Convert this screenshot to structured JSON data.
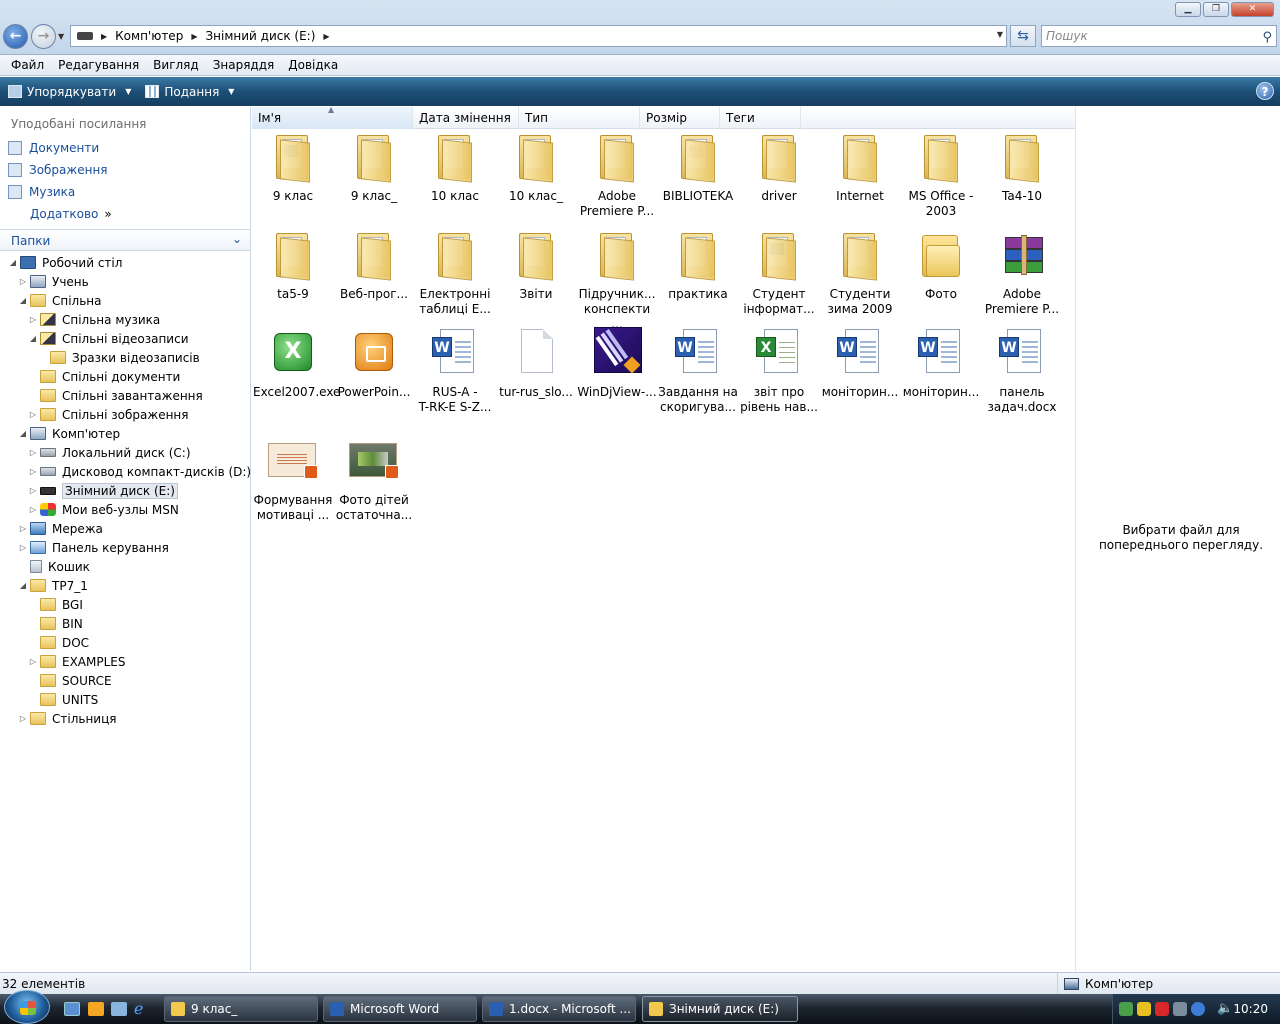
{
  "window": {
    "minimize_label": "▁",
    "maximize_label": "❐",
    "close_label": "✕"
  },
  "address": {
    "segments": [
      "Комп'ютер",
      "Знімний диск (E:)"
    ],
    "search_placeholder": "Пошук"
  },
  "menu": [
    "Файл",
    "Редагування",
    "Вигляд",
    "Знаряддя",
    "Довідка"
  ],
  "toolbar": {
    "organize": "Упорядкувати",
    "views": "Подання",
    "help": "?"
  },
  "favorites": {
    "title": "Уподобані посилання",
    "links": [
      "Документи",
      "Зображення",
      "Музика"
    ],
    "more": "Додатково",
    "more_glyph": "»"
  },
  "folders_pane": {
    "title": "Папки",
    "tree": [
      {
        "label": "Робочий стіл",
        "icon": "desktop-icon"
      },
      {
        "label": "Учень",
        "icon": "user-folder-icon"
      },
      {
        "label": "Спільна",
        "icon": "folder-icon"
      },
      {
        "label": "Спільна музика",
        "icon": "music-folder-icon"
      },
      {
        "label": "Спільні відеозаписи",
        "icon": "video-folder-icon"
      },
      {
        "label": "Зразки відеозаписів",
        "icon": "folder-icon"
      },
      {
        "label": "Спільні документи",
        "icon": "folder-icon"
      },
      {
        "label": "Спільні завантаження",
        "icon": "folder-icon"
      },
      {
        "label": "Спільні зображення",
        "icon": "folder-icon"
      },
      {
        "label": "Комп'ютер",
        "icon": "computer-icon"
      },
      {
        "label": "Локальний диск (C:)",
        "icon": "drive-icon"
      },
      {
        "label": "Дисковод компакт-дисків (D:)",
        "icon": "cd-drive-icon"
      },
      {
        "label": "Знімний диск (E:)",
        "icon": "removable-drive-icon"
      },
      {
        "label": "Мои веб-узлы MSN",
        "icon": "msn-icon"
      },
      {
        "label": "Мережа",
        "icon": "network-icon"
      },
      {
        "label": "Панель керування",
        "icon": "control-panel-icon"
      },
      {
        "label": "Кошик",
        "icon": "recycle-bin-icon"
      },
      {
        "label": "TP7_1",
        "icon": "folder-icon"
      },
      {
        "label": "BGI",
        "icon": "folder-icon"
      },
      {
        "label": "BIN",
        "icon": "folder-icon"
      },
      {
        "label": "DOC",
        "icon": "folder-icon"
      },
      {
        "label": "EXAMPLES",
        "icon": "folder-icon"
      },
      {
        "label": "SOURCE",
        "icon": "folder-icon"
      },
      {
        "label": "UNITS",
        "icon": "folder-icon"
      },
      {
        "label": "Стільниця",
        "icon": "folder-icon"
      }
    ]
  },
  "columns": [
    "Ім'я",
    "Дата змінення",
    "Тип",
    "Розмір",
    "Теги"
  ],
  "files": [
    {
      "line1": "9 клас",
      "line2": "",
      "icon": "folder-icon"
    },
    {
      "line1": "9 клас_",
      "line2": "",
      "icon": "folder-icon"
    },
    {
      "line1": "10 клас",
      "line2": "",
      "icon": "folder-icon"
    },
    {
      "line1": "10 клас_",
      "line2": "",
      "icon": "folder-icon"
    },
    {
      "line1": "Adobe",
      "line2": "Premiere P...",
      "icon": "folder-icon"
    },
    {
      "line1": "BIBLIOTEKA",
      "line2": "",
      "icon": "folder-icon"
    },
    {
      "line1": "driver",
      "line2": "",
      "icon": "folder-icon"
    },
    {
      "line1": "Internet",
      "line2": "",
      "icon": "folder-icon"
    },
    {
      "line1": "MS Office -",
      "line2": "2003",
      "icon": "folder-icon"
    },
    {
      "line1": "Ta4-10",
      "line2": "",
      "icon": "folder-icon"
    },
    {
      "line1": "ta5-9",
      "line2": "",
      "icon": "folder-icon"
    },
    {
      "line1": "Веб-прог...",
      "line2": "",
      "icon": "folder-icon"
    },
    {
      "line1": "Електронні",
      "line2": "таблиці Е...",
      "icon": "folder-icon"
    },
    {
      "line1": "Звіти",
      "line2": "",
      "icon": "folder-icon"
    },
    {
      "line1": "Підручник...",
      "line2": "конспекти ...",
      "icon": "folder-icon"
    },
    {
      "line1": "практика",
      "line2": "",
      "icon": "folder-icon"
    },
    {
      "line1": "Студент",
      "line2": "інформат...",
      "icon": "folder-icon"
    },
    {
      "line1": "Студенти",
      "line2": "зима 2009",
      "icon": "folder-icon"
    },
    {
      "line1": "Фото",
      "line2": "",
      "icon": "folder-icon"
    },
    {
      "line1": "Adobe",
      "line2": "Premiere P...",
      "icon": "winrar-archive-icon"
    },
    {
      "line1": "Excel2007.exe",
      "line2": "",
      "icon": "excel-exe-icon"
    },
    {
      "line1": "PowerPoin...",
      "line2": "",
      "icon": "powerpoint-exe-icon"
    },
    {
      "line1": "RUS-A -",
      "line2": "T-RK-E S-Z...",
      "icon": "word-document-icon"
    },
    {
      "line1": "tur-rus_slo...",
      "line2": "",
      "icon": "blank-file-icon"
    },
    {
      "line1": "WinDjView-...",
      "line2": "",
      "icon": "windjview-icon"
    },
    {
      "line1": "Завдання на",
      "line2": "скоригува...",
      "icon": "word-document-icon"
    },
    {
      "line1": "звіт про",
      "line2": "рівень нав...",
      "icon": "excel-document-icon"
    },
    {
      "line1": "моніторин...",
      "line2": "",
      "icon": "word-document-icon"
    },
    {
      "line1": "моніторин...",
      "line2": "",
      "icon": "word-document-icon"
    },
    {
      "line1": "панель",
      "line2": "задач.docx",
      "icon": "word-document-icon"
    },
    {
      "line1": "Формування",
      "line2": "мотиваці ...",
      "icon": "powerpoint-slide-icon"
    },
    {
      "line1": "Фото дітей",
      "line2": "остаточна...",
      "icon": "powerpoint-photo-icon"
    }
  ],
  "preview": {
    "text": "Вибрати файл для попереднього перегляду."
  },
  "status": {
    "count": "32 елементів",
    "location": "Комп'ютер"
  },
  "taskbar": {
    "tasks": [
      "9 клас_",
      "Microsoft Word",
      "1.docx - Microsoft ...",
      "Знімний диск (E:)"
    ],
    "clock": "10:20"
  },
  "colors": {
    "link": "#1b4f9b",
    "toolbar": "#1d4f77",
    "folder": "#e8c35c"
  }
}
